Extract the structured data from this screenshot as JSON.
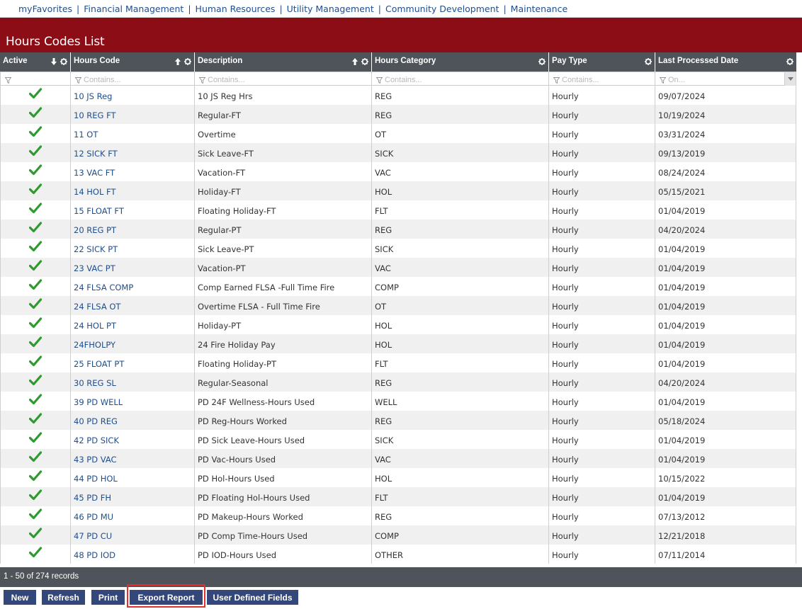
{
  "nav": [
    "myFavorites",
    "Financial Management",
    "Human Resources",
    "Utility Management",
    "Community Development",
    "Maintenance"
  ],
  "page_title": "Hours Codes List",
  "columns": [
    {
      "label": "Active",
      "sort": "desc",
      "gear": true
    },
    {
      "label": "Hours Code",
      "sort": "asc",
      "gear": true
    },
    {
      "label": "Description",
      "sort": "asc",
      "gear": true
    },
    {
      "label": "Hours Category",
      "gear": true
    },
    {
      "label": "Pay Type",
      "gear": true
    },
    {
      "label": "Last Processed Date",
      "gear": true
    }
  ],
  "filters": [
    "",
    "Contains...",
    "Contains...",
    "Contains...",
    "Contains...",
    "On..."
  ],
  "rows": [
    [
      "10 JS Reg",
      "10 JS Reg Hrs",
      "REG",
      "Hourly",
      "09/07/2024"
    ],
    [
      "10 REG FT",
      "Regular-FT",
      "REG",
      "Hourly",
      "10/19/2024"
    ],
    [
      "11 OT",
      "Overtime",
      "OT",
      "Hourly",
      "03/31/2024"
    ],
    [
      "12 SICK FT",
      "Sick Leave-FT",
      "SICK",
      "Hourly",
      "09/13/2019"
    ],
    [
      "13 VAC FT",
      "Vacation-FT",
      "VAC",
      "Hourly",
      "08/24/2024"
    ],
    [
      "14 HOL FT",
      "Holiday-FT",
      "HOL",
      "Hourly",
      "05/15/2021"
    ],
    [
      "15 FLOAT FT",
      "Floating Holiday-FT",
      "FLT",
      "Hourly",
      "01/04/2019"
    ],
    [
      "20 REG PT",
      "Regular-PT",
      "REG",
      "Hourly",
      "04/20/2024"
    ],
    [
      "22 SICK PT",
      "Sick Leave-PT",
      "SICK",
      "Hourly",
      "01/04/2019"
    ],
    [
      "23 VAC PT",
      "Vacation-PT",
      "VAC",
      "Hourly",
      "01/04/2019"
    ],
    [
      "24 FLSA COMP",
      "Comp Earned FLSA -Full Time Fire",
      "COMP",
      "Hourly",
      "01/04/2019"
    ],
    [
      "24 FLSA OT",
      "Overtime FLSA - Full Time Fire",
      "OT",
      "Hourly",
      "01/04/2019"
    ],
    [
      "24 HOL PT",
      "Holiday-PT",
      "HOL",
      "Hourly",
      "01/04/2019"
    ],
    [
      "24FHOLPY",
      "24 Fire Holiday Pay",
      "HOL",
      "Hourly",
      "01/04/2019"
    ],
    [
      "25 FLOAT PT",
      "Floating Holiday-PT",
      "FLT",
      "Hourly",
      "01/04/2019"
    ],
    [
      "30 REG SL",
      "Regular-Seasonal",
      "REG",
      "Hourly",
      "04/20/2024"
    ],
    [
      "39 PD WELL",
      "PD 24F Wellness-Hours Used",
      "WELL",
      "Hourly",
      "01/04/2019"
    ],
    [
      "40 PD REG",
      "PD Reg-Hours Worked",
      "REG",
      "Hourly",
      "05/18/2024"
    ],
    [
      "42 PD SICK",
      "PD Sick Leave-Hours Used",
      "SICK",
      "Hourly",
      "01/04/2019"
    ],
    [
      "43 PD VAC",
      "PD Vac-Hours Used",
      "VAC",
      "Hourly",
      "01/04/2019"
    ],
    [
      "44 PD HOL",
      "PD Hol-Hours Used",
      "HOL",
      "Hourly",
      "10/15/2022"
    ],
    [
      "45 PD FH",
      "PD Floating Hol-Hours Used",
      "FLT",
      "Hourly",
      "01/04/2019"
    ],
    [
      "46 PD MU",
      "PD Makeup-Hours Worked",
      "REG",
      "Hourly",
      "07/13/2012"
    ],
    [
      "47 PD CU",
      "PD Comp Time-Hours Used",
      "COMP",
      "Hourly",
      "12/21/2018"
    ],
    [
      "48 PD IOD",
      "PD IOD-Hours Used",
      "OTHER",
      "Hourly",
      "07/11/2014"
    ]
  ],
  "record_count": "1 - 50 of 274 records",
  "buttons": [
    "New",
    "Refresh",
    "Print",
    "Export Report",
    "User Defined Fields"
  ],
  "colors": {
    "title_bar": "#8d0d17",
    "header": "#4e5459",
    "button": "#34477a",
    "link": "#1f4e8c",
    "check": "#2e9a2e"
  }
}
